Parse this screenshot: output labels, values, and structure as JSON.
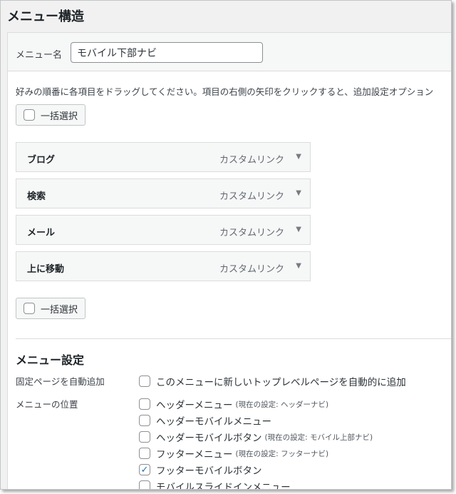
{
  "section_title": "メニュー構造",
  "menu_name": {
    "label": "メニュー名",
    "value": "モバイル下部ナビ"
  },
  "instructions": "好みの順番に各項目をドラッグしてください。項目の右側の矢印をクリックすると、追加設定オプション",
  "bulk_select_label": "一括選択",
  "menu_items": [
    {
      "title": "ブログ",
      "type": "カスタムリンク"
    },
    {
      "title": "検索",
      "type": "カスタムリンク"
    },
    {
      "title": "メール",
      "type": "カスタムリンク"
    },
    {
      "title": "上に移動",
      "type": "カスタムリンク"
    }
  ],
  "settings": {
    "heading": "メニュー設定",
    "auto_add": {
      "label": "固定ページを自動追加",
      "option": "このメニューに新しいトップレベルページを自動的に追加",
      "checked": false
    },
    "locations": {
      "label": "メニューの位置",
      "options": [
        {
          "text": "ヘッダーメニュー",
          "note": "(現在の設定: ヘッダーナビ)",
          "checked": false
        },
        {
          "text": "ヘッダーモバイルメニュー",
          "note": "",
          "checked": false
        },
        {
          "text": "ヘッダーモバイルボタン",
          "note": "(現在の設定: モバイル上部ナビ)",
          "checked": false
        },
        {
          "text": "フッターメニュー",
          "note": "(現在の設定: フッターナビ)",
          "checked": false
        },
        {
          "text": "フッターモバイルボタン",
          "note": "",
          "checked": true
        },
        {
          "text": "モバイルスライドインメニュー",
          "note": "",
          "checked": false
        }
      ]
    }
  },
  "icons": {
    "expand": "triangle-down-icon",
    "checked": "checkmark-icon"
  },
  "colors": {
    "accent": "#2271b1",
    "panel_bg": "#f6f7f7",
    "border": "#dcdcde"
  }
}
